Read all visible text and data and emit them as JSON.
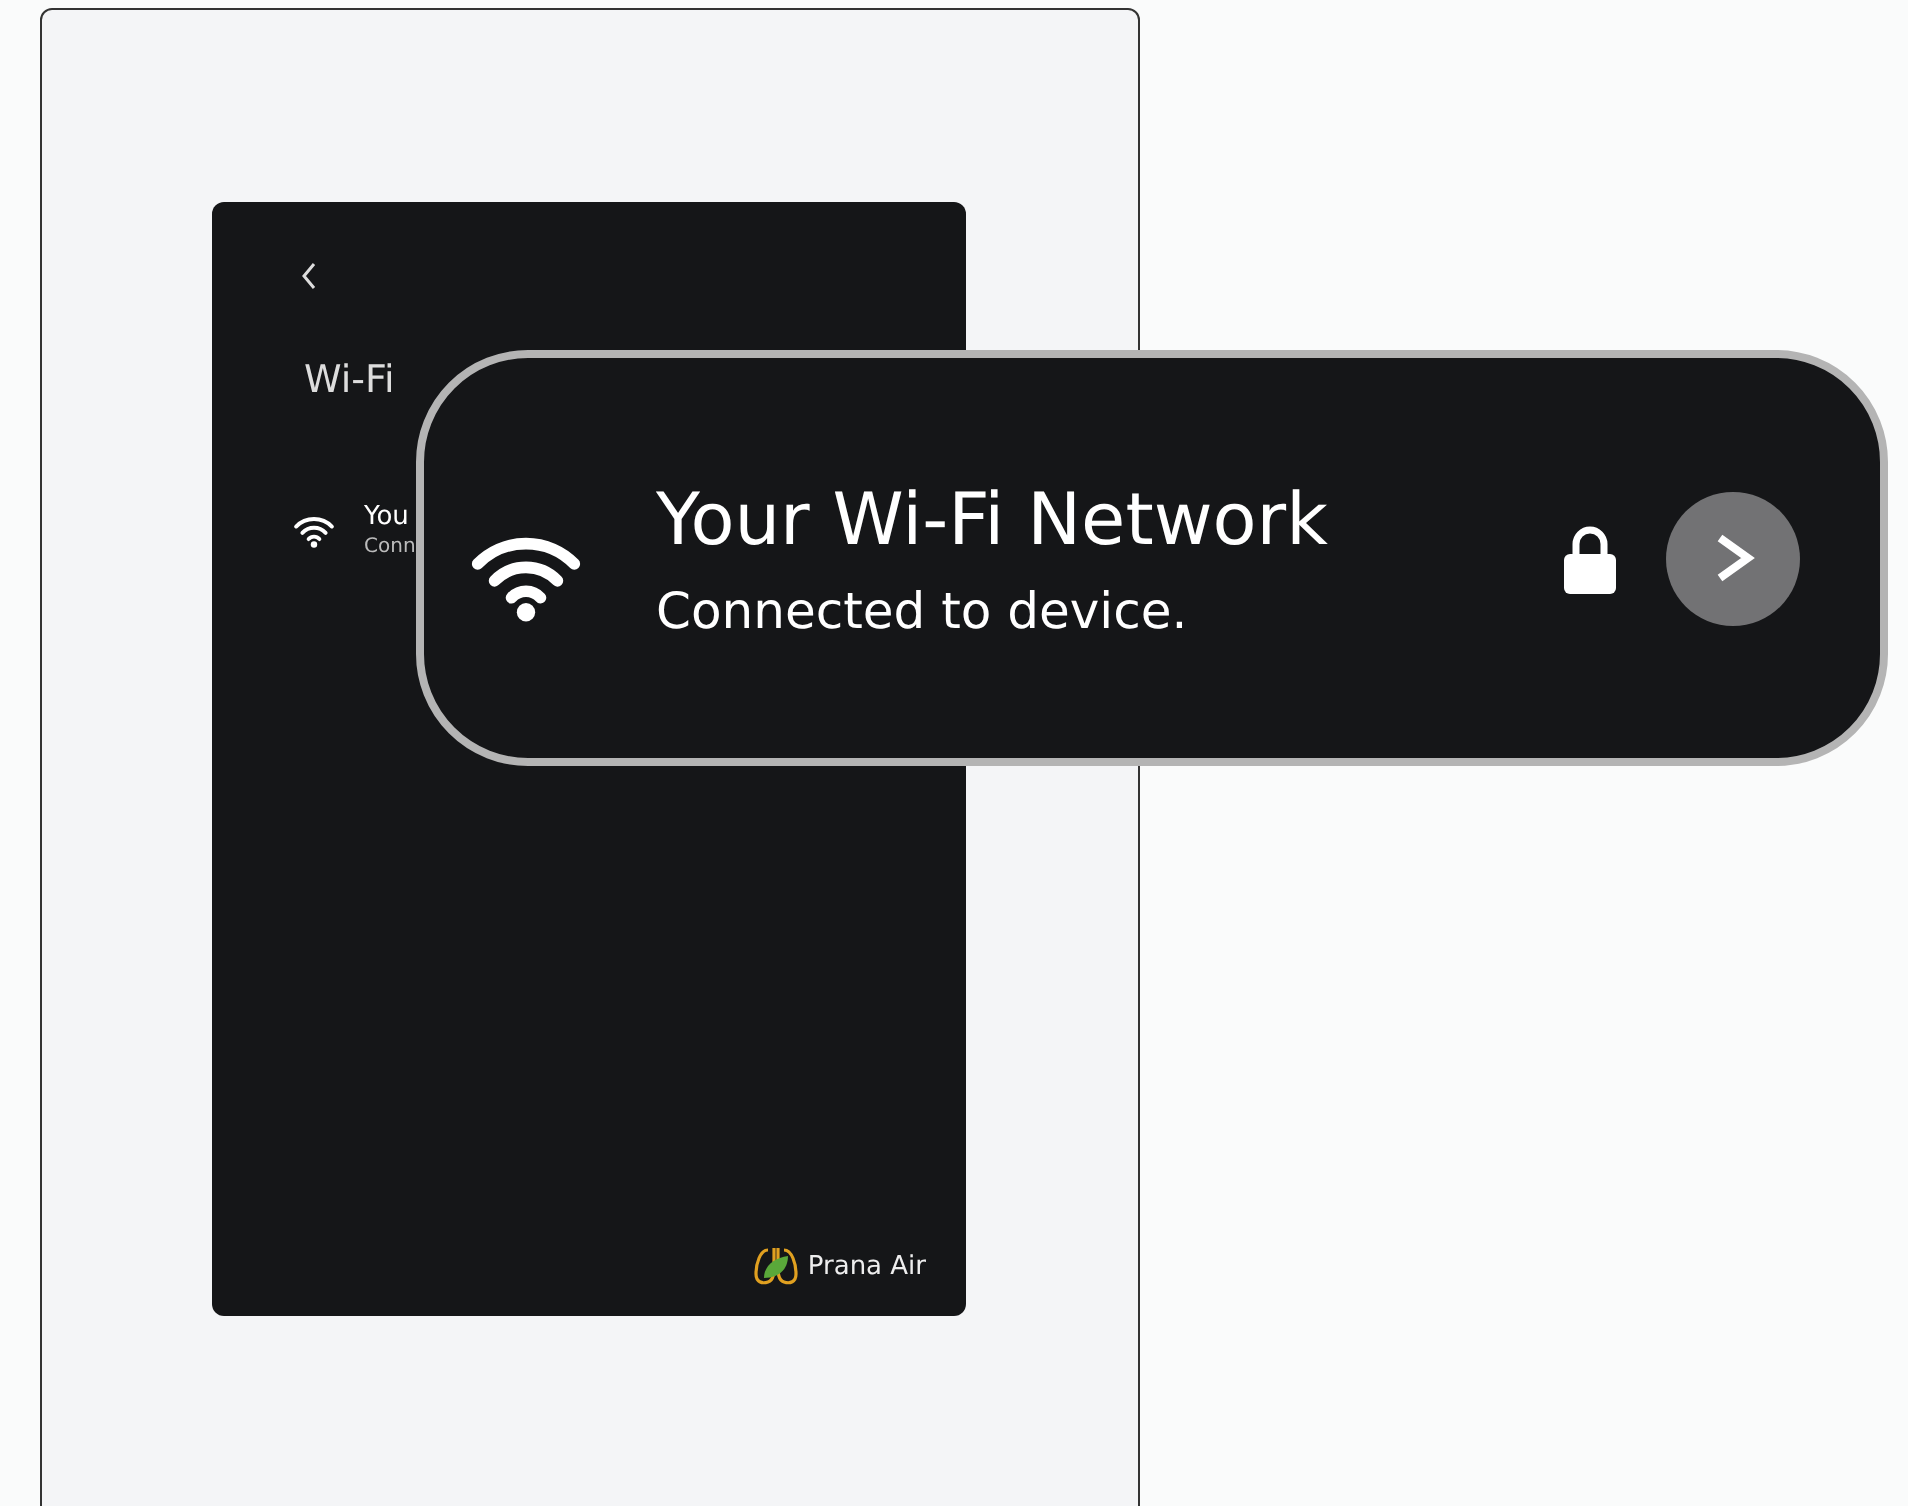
{
  "screen": {
    "title": "Wi-Fi",
    "network": {
      "name": "You",
      "status": "Conn"
    },
    "brand": "Prana Air"
  },
  "callout": {
    "name": "Your Wi-Fi Network",
    "status": "Connected to device.",
    "locked": true
  }
}
